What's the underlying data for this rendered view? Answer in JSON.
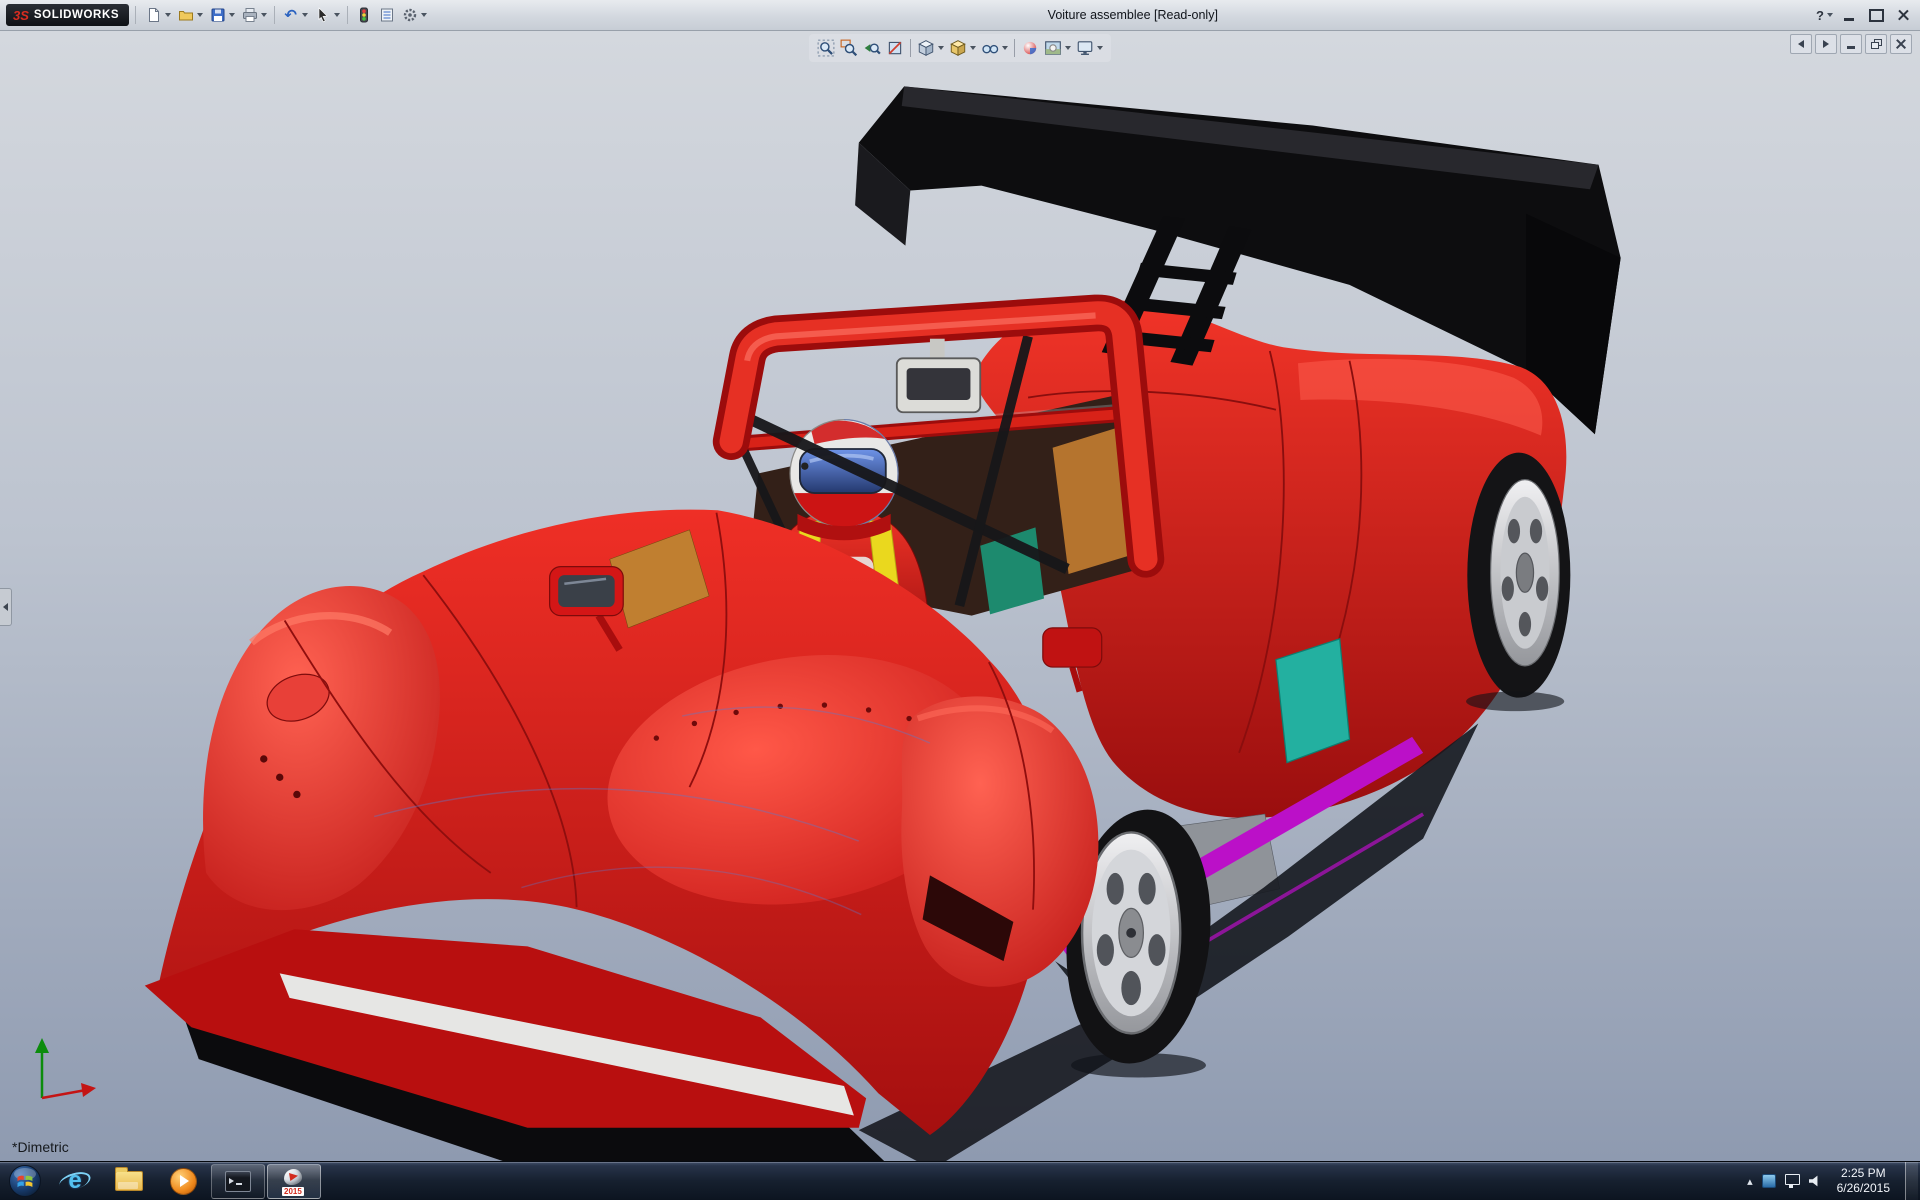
{
  "titlebar": {
    "logo_mark": "3S",
    "app_name": "SOLIDWORKS",
    "title": "Voiture assemblee [Read-only]",
    "help_label": "?"
  },
  "toolbar_icons": [
    "new-document-icon",
    "open-icon",
    "save-icon",
    "print-icon",
    "undo-icon",
    "select-cursor-icon",
    "rebuild-icon",
    "file-properties-icon",
    "options-icon"
  ],
  "headsup_icons": [
    "zoom-to-fit-icon",
    "zoom-to-area-icon",
    "previous-view-icon",
    "section-view-icon",
    "view-orientation-icon",
    "display-style-icon",
    "hide-show-items-icon",
    "edit-appearance-icon",
    "apply-scene-icon",
    "view-settings-icon"
  ],
  "doc_window_icons": [
    "pane-collapse-icon",
    "pane-expand-icon",
    "doc-minimize-icon",
    "doc-restore-icon",
    "doc-close-icon"
  ],
  "viewport": {
    "view_label": "*Dimetric"
  },
  "glyphs": {
    "undo": "↶",
    "ie": "e",
    "tray_expand": "▴"
  },
  "colors": {
    "body_red": "#d81e14",
    "accent_teal": "#1fb3a3",
    "accent_magenta": "#bb10c8",
    "harness_yellow": "#ead81e",
    "viewport_top": "#d4d8de",
    "viewport_bottom": "#8e9ab0",
    "taskbar": "#16202f"
  },
  "taskbar": {
    "items": [
      "start",
      "internet-explorer",
      "file-explorer",
      "media-player",
      "command-prompt",
      "solidworks"
    ],
    "solidworks_badge": "2015",
    "clock": {
      "time": "2:25 PM",
      "date": "6/26/2015"
    }
  }
}
